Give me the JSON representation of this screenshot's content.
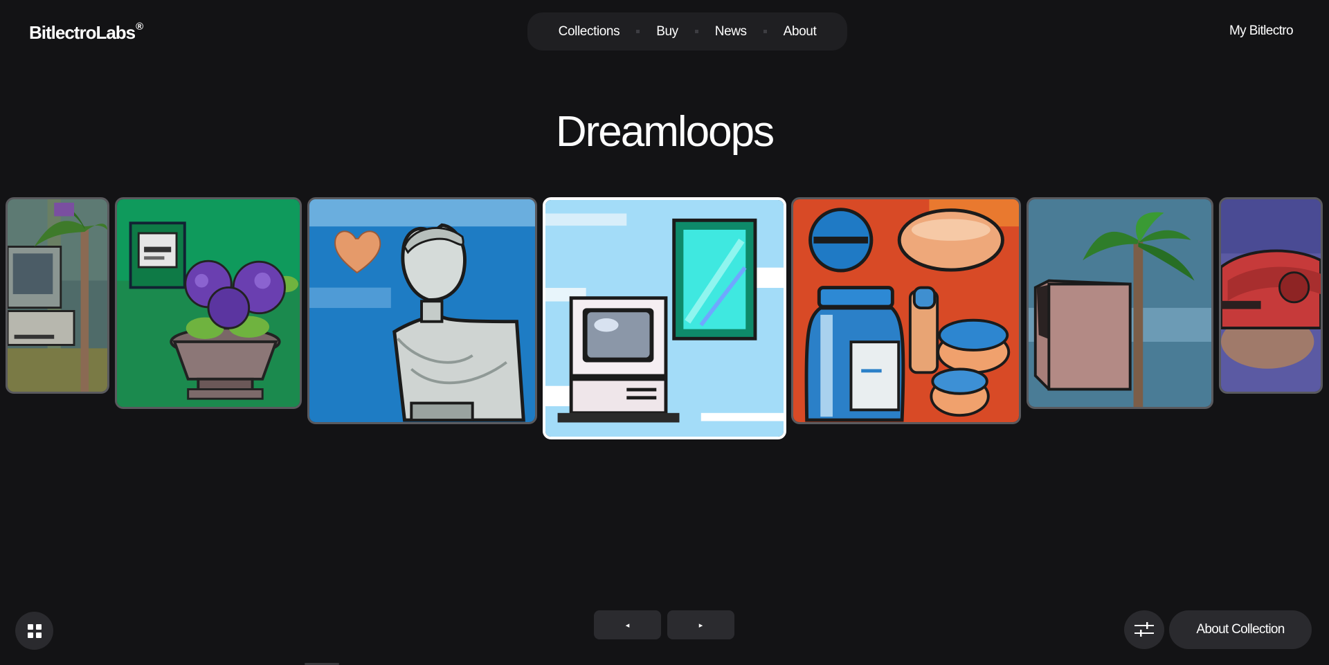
{
  "brand": {
    "name": "BitlectroLabs",
    "mark": "®"
  },
  "nav": {
    "items": [
      "Collections",
      "Buy",
      "News",
      "About"
    ]
  },
  "account": {
    "label": "My Bitlectro"
  },
  "collection": {
    "title": "Dreamloops"
  },
  "carousel": {
    "items": [
      {
        "subject": "palm tree and computer",
        "active": false
      },
      {
        "subject": "potted purple flowers",
        "active": false
      },
      {
        "subject": "classical bust with heart",
        "active": false
      },
      {
        "subject": "retro computer and mirror",
        "active": true
      },
      {
        "subject": "jars and containers",
        "active": false
      },
      {
        "subject": "palm tree and box",
        "active": false
      },
      {
        "subject": "red rotary telephone",
        "active": false
      }
    ]
  },
  "controls": {
    "prev_label": "◂",
    "next_label": "▸",
    "grid_icon": "grid-icon",
    "filter_icon": "sliders-icon",
    "about_label": "About Collection"
  },
  "colors": {
    "background": "#131315",
    "pill": "#1f1f22",
    "button": "#2a2a2e",
    "active_border": "#ffffff"
  }
}
